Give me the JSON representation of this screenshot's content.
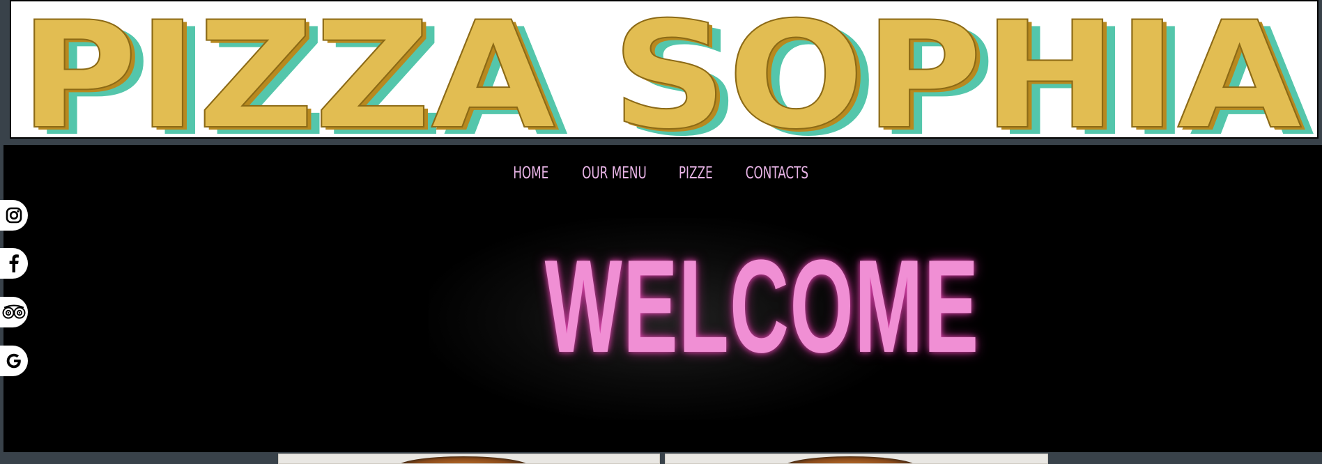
{
  "brand": {
    "logo_text": "PIZZA SOPHIA",
    "logo_fill": "#e2bd52",
    "logo_shadow": "#54c6ab",
    "logo_edge": "#b8891f"
  },
  "nav": {
    "items": [
      {
        "label": "HOME"
      },
      {
        "label": "OUR MENU"
      },
      {
        "label": "PIZZE"
      },
      {
        "label": "CONTACTS"
      }
    ],
    "color": "#e8b4e6"
  },
  "hero": {
    "heading": "WELCOME",
    "color": "#f08fd4"
  },
  "social": [
    {
      "icon": "instagram-icon"
    },
    {
      "icon": "facebook-icon"
    },
    {
      "icon": "tripadvisor-icon"
    },
    {
      "icon": "google-icon"
    }
  ],
  "colors": {
    "frame": "#39424a",
    "background": "#000000"
  }
}
